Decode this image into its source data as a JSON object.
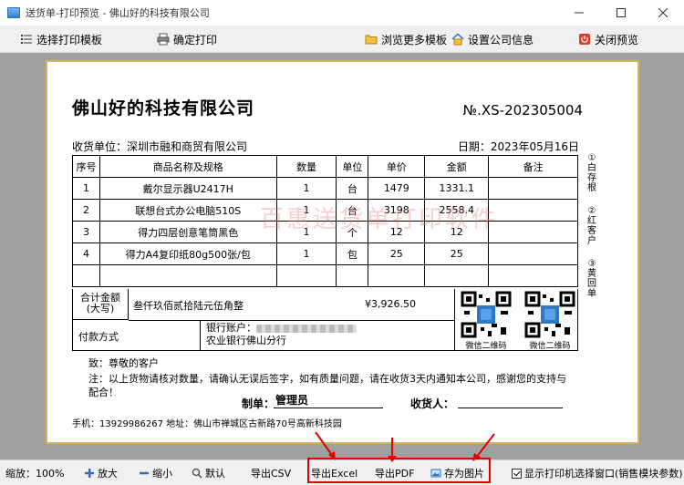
{
  "window": {
    "title": "送货单-打印预览 - 佛山好的科技有限公司",
    "controls": [
      "minimize",
      "maximize",
      "close"
    ]
  },
  "toolbar": {
    "select_template": "选择打印模板",
    "confirm_print": "确定打印",
    "browse_more": "浏览更多模板",
    "company_settings": "设置公司信息",
    "close_preview": "关闭预览"
  },
  "document": {
    "company": "佛山好的科技有限公司",
    "doc_no": "№.XS-202305004",
    "receiver": "收货单位：深圳市融和商贸有限公司",
    "date": "日期：2023年05月16日",
    "columns": [
      "序号",
      "商品名称及规格",
      "数量",
      "单位",
      "单价",
      "金额",
      "备注"
    ],
    "rows": [
      [
        "1",
        "戴尔显示器U2417H",
        "1",
        "台",
        "1479",
        "1331.1",
        ""
      ],
      [
        "2",
        "联想台式办公电脑510S",
        "1",
        "台",
        "3198",
        "2558.4",
        ""
      ],
      [
        "3",
        "得力四层创意笔筒黑色",
        "1",
        "个",
        "12",
        "12",
        ""
      ],
      [
        "4",
        "得力A4复印纸80g500张/包",
        "1",
        "包",
        "25",
        "25",
        ""
      ]
    ],
    "side_note": [
      "①",
      "白",
      "存",
      "根",
      "②",
      "红",
      "客",
      "户",
      "③",
      "黄",
      "回",
      "单"
    ],
    "total_label_1": "合计金额",
    "total_label_2": "(大写)",
    "total_text": "叁仟玖佰贰拾陆元伍角整",
    "total_amount": "¥3,926.50",
    "payment_label": "付款方式",
    "bank_account_label": "银行账户：",
    "bank_name": "农业银行佛山分行",
    "qr_caption": "微信二维码",
    "greeting": "致：尊敬的客户",
    "notice": "注：以上货物请核对数量，请确认无误后签字，如有质量问题，请在收货3天内通知本公司，感谢您的支持与配合！",
    "maker_label": "制单：",
    "maker_value": "管理员",
    "receiver_sign_label": "收货人：",
    "contact": "手机：13929986267  地址：佛山市禅城区古新路70号高新科技园",
    "watermark": "百惠送货单打印软件"
  },
  "bottombar": {
    "zoom": "缩放：100%",
    "zoom_in": "放大",
    "zoom_out": "缩小",
    "default": "默认",
    "export_csv": "导出CSV",
    "export_excel": "导出Excel",
    "export_pdf": "导出PDF",
    "save_image": "存为图片",
    "show_printer": "显示打印机选择窗口(销售模块参数)"
  },
  "colors": {
    "highlight": "#e00000",
    "paper_border": "#d8b25a",
    "preview_bg": "#a0a0a0"
  }
}
